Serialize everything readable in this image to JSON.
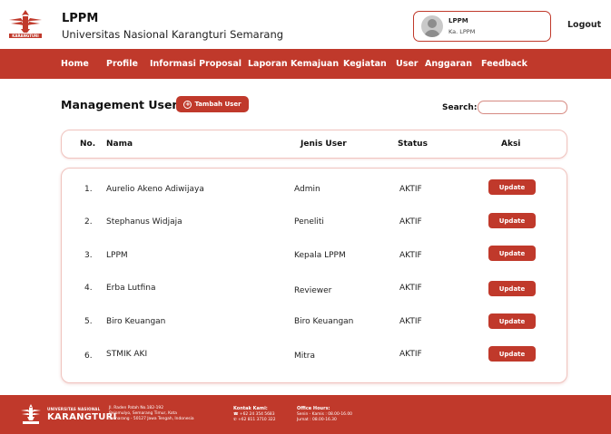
{
  "header": {
    "title": "LPPM",
    "subtitle": "Universitas Nasional Karangturi Semarang",
    "logo_text": "KARANGTURI",
    "profile_name": "LPPM",
    "profile_role": "Ka. LPPM",
    "logout_label": "Logout"
  },
  "nav": {
    "items": [
      "Home",
      "Profile",
      "Informasi Proposal",
      "Laporan Kemajuan",
      "Kegiatan",
      "User",
      "Anggaran",
      "Feedback"
    ]
  },
  "page": {
    "title": "Management User",
    "add_button_label": "Tambah User",
    "search_label": "Search:",
    "search_value": "",
    "search_placeholder": ""
  },
  "table": {
    "headers": [
      "No.",
      "Nama",
      "Jenis User",
      "Status",
      "Aksi"
    ],
    "rows": [
      {
        "no": "1.",
        "nama": "Aurelio Akeno Adiwijaya",
        "jenis": "Admin",
        "status": "AKTIF",
        "aksi": "Update"
      },
      {
        "no": "2.",
        "nama": "Stephanus Widjaja",
        "jenis": "Peneliti",
        "status": "AKTIF",
        "aksi": "Update"
      },
      {
        "no": "3.",
        "nama": "LPPM",
        "jenis": "Kepala LPPM",
        "status": "AKTIF",
        "aksi": "Update"
      },
      {
        "no": "4.",
        "nama": "Erba Lutfina",
        "jenis": "Reviewer",
        "status": "AKTIF",
        "aksi": "Update"
      },
      {
        "no": "5.",
        "nama": "Biro Keuangan",
        "jenis": "Biro Keuangan",
        "status": "AKTIF",
        "aksi": "Update"
      },
      {
        "no": "6.",
        "nama": "STMIK AKI",
        "jenis": "Mitra",
        "status": "AKTIF",
        "aksi": "Update"
      }
    ]
  },
  "footer": {
    "univ_small": "UNIVERSITAS NASIONAL",
    "univ_big": "KARANGTURI",
    "address_lines": [
      "Jl. Raden Patah No.182-192",
      "Rejomulyo, Semarang Timur, Kota",
      "Semarang - 50127 Jawa Tengah, Indonesia"
    ],
    "contact_title": "Kontak Kami:",
    "contact_phone": "+62 24 354 5683",
    "contact_wa": "+62 811 3710 322",
    "office_title": "Office Hours:",
    "office_line1": "Senin - Kamis : 08.00-16.00",
    "office_line2": "Jumat : 08.00-16.30"
  },
  "colors": {
    "brand_red": "#c0392b",
    "border_pink": "#f0c4bf"
  }
}
